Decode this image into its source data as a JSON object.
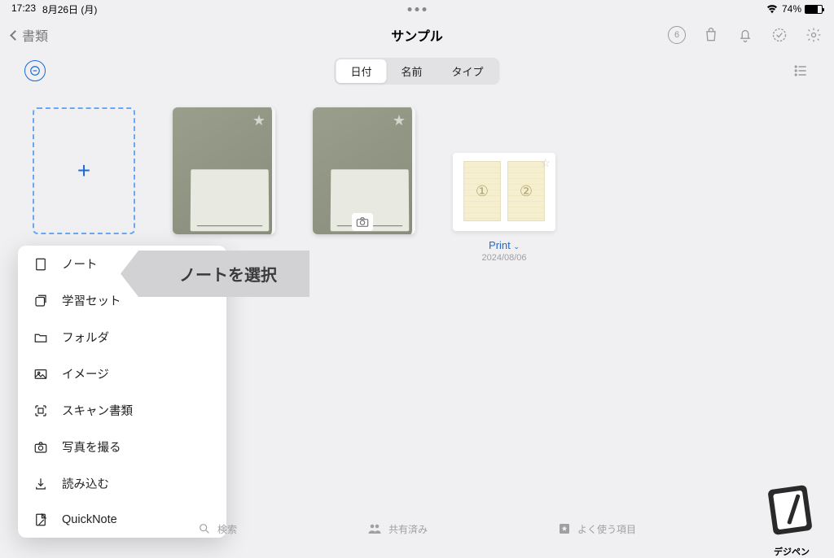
{
  "status": {
    "time": "17:23",
    "date": "8月26日 (月)",
    "battery_pct": "74%",
    "battery_fill": "74%"
  },
  "nav": {
    "back_label": "書類",
    "title": "サンプル",
    "badge": "6"
  },
  "sort": {
    "opt_date": "日付",
    "opt_name": "名前",
    "opt_type": "タイプ"
  },
  "items": {
    "print": {
      "title": "Print",
      "date": "2024/08/06",
      "p1": "①",
      "p2": "②"
    }
  },
  "menu": {
    "note": "ノート",
    "study": "学習セット",
    "folder": "フォルダ",
    "image": "イメージ",
    "scan": "スキャン書類",
    "photo": "写真を撮る",
    "import": "読み込む",
    "quick": "QuickNote"
  },
  "annotation": "ノートを選択",
  "tabs": {
    "search": "検索",
    "shared": "共有済み",
    "fav": "よく使う項目"
  },
  "logo_text": "デジペン"
}
